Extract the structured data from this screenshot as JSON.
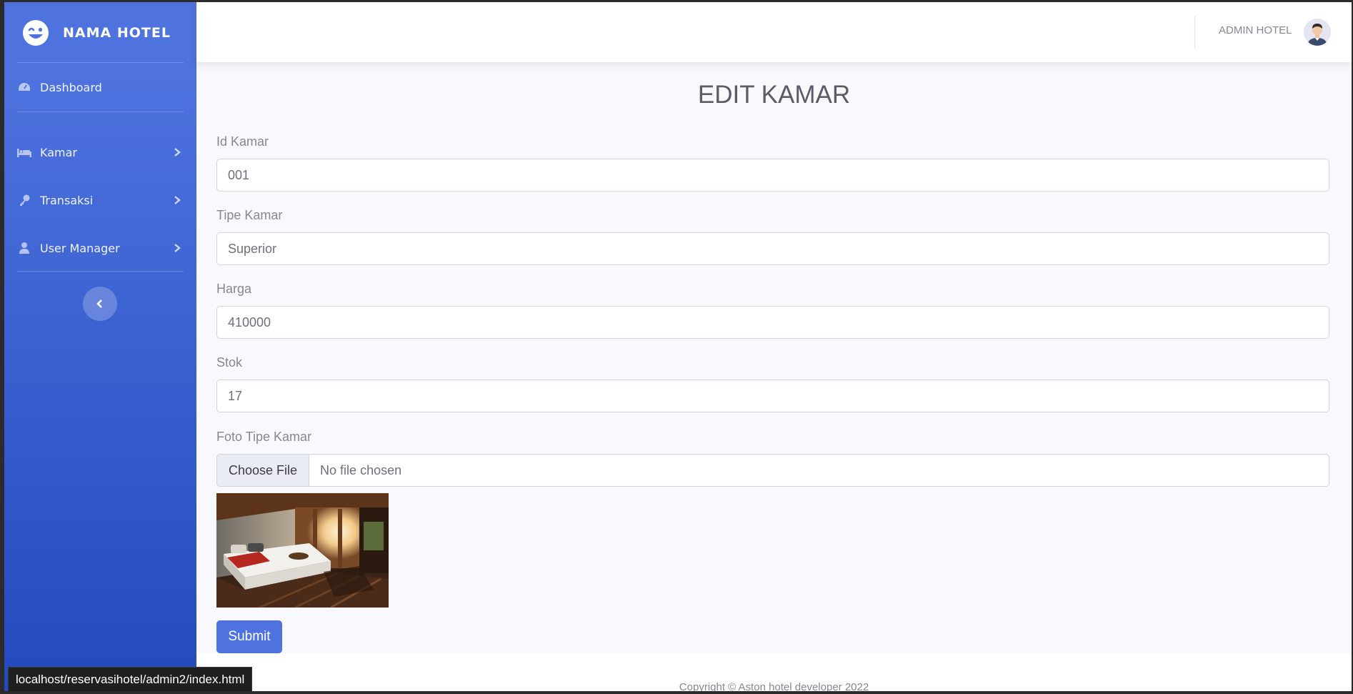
{
  "sidebar": {
    "brand": "NAMA HOTEL",
    "brand_icon": "laugh-wink-icon",
    "items": [
      {
        "label": "Dashboard",
        "icon": "tachometer-icon"
      },
      {
        "label": "Kamar",
        "icon": "bed-icon"
      },
      {
        "label": "Transaksi",
        "icon": "key-icon"
      },
      {
        "label": "User Manager",
        "icon": "user-icon"
      }
    ],
    "toggle_icon": "chevron-left-icon"
  },
  "topbar": {
    "user_name": "ADMIN HOTEL",
    "avatar": "avatar"
  },
  "form": {
    "title": "EDIT KAMAR",
    "fields": [
      {
        "label": "Id Kamar",
        "value": "001"
      },
      {
        "label": "Tipe Kamar",
        "value": "Superior"
      },
      {
        "label": "Harga",
        "value": "410000"
      },
      {
        "label": "Stok",
        "value": "17"
      }
    ],
    "photo": {
      "label": "Foto Tipe Kamar",
      "button": "Choose File",
      "status": "No file chosen"
    },
    "submit": "Submit"
  },
  "footer": {
    "copyright": "Copyright © Aston hotel developer 2022"
  },
  "status_bar": {
    "url": "localhost/reservasihotel/admin2/index.html"
  },
  "colors": {
    "primary": "#4e73df",
    "sidebar_bottom": "#224abe",
    "background": "#f8f9fc"
  }
}
